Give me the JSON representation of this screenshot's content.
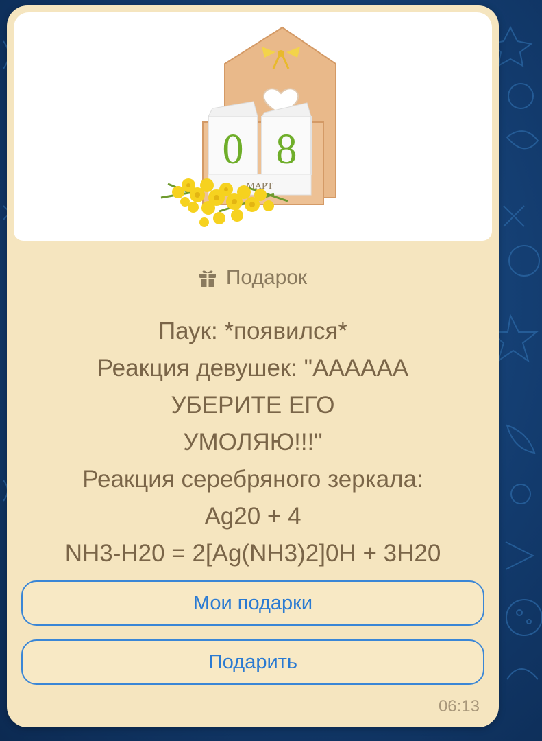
{
  "gift": {
    "calendar_day": [
      "0",
      "8"
    ],
    "calendar_month": "МАРТ",
    "header_label": "Подарок",
    "message": "Паук: *появился*\nРеакция девушек: \"АААААА\nУБЕРИТЕ ЕГО\nУМОЛЯЮ!!!\"\nРеакция серебряного зеркала:\nAg20 + 4\nNH3-H20 = 2[Ag(NH3)2]0H + 3H20"
  },
  "buttons": {
    "my_gifts": "Мои подарки",
    "give": "Подарить"
  },
  "time": "06:13",
  "colors": {
    "bubble": "#f5e5bf",
    "button_border": "#3a86d6",
    "button_text": "#2a7ad2",
    "message_text": "#7a6548",
    "background": "#123a6c"
  }
}
